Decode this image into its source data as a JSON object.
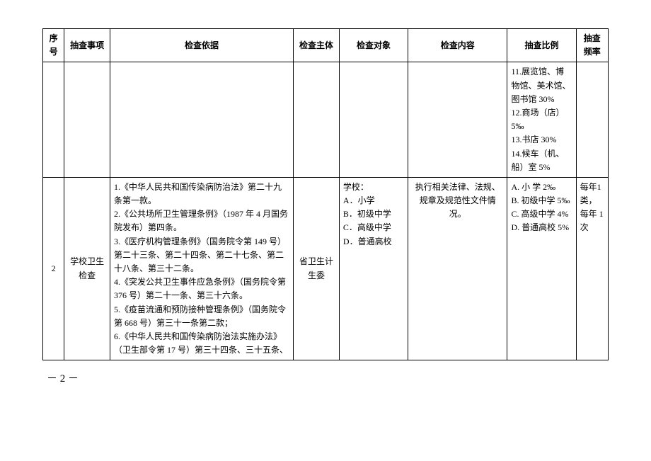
{
  "headers": {
    "seq": "序号",
    "item": "抽查事项",
    "basis": "检查依据",
    "subject": "检查主体",
    "target": "检查对象",
    "content": "检查内容",
    "ratio": "抽查比例",
    "freq": "抽查频率"
  },
  "row1": {
    "ratio_lines": {
      "l1": "11.展览馆、博物馆、美术馆、图书馆 30%",
      "l2": "12.商场（店）5‰",
      "l3": "13.书店  30%",
      "l4": "14.候车（机、船）室 5%"
    }
  },
  "row2": {
    "seq": "2",
    "item": "学校卫生检查",
    "basis": {
      "b1": "1.《中华人民共和国传染病防治法》第二十九条第一款。",
      "b2": "2.《公共场所卫生管理条例》（1987 年 4 月国务院发布）第四条。",
      "b3": "3.《医疗机构管理条例》（国务院令第 149 号）第二十三条、第二十四条、第二十七条、第二十八条、第三十二条。",
      "b4": "4.《突发公共卫生事件应急条例》（国务院令第 376 号）第二十一条、第三十六条。",
      "b5": "5.《疫苗流通和预防接种管理条例》（国务院令第 668 号）第三十一条第二款；",
      "b6": "6.《中华人民共和国传染病防治法实施办法》（卫生部令第 17 号）第三十四条、三十五条、"
    },
    "subject": "省卫生计生委",
    "target": {
      "t0": "学校：",
      "t1": "A．小学",
      "t2": "B．初级中学",
      "t3": "C．高级中学",
      "t4": "D．普通高校"
    },
    "content": "执行相关法律、法规、规章及规范性文件情况。",
    "ratio": {
      "r1": "A. 小  学 2‰",
      "r2": "B. 初级中学  5‰",
      "r3": "C. 高级中学  4%",
      "r4": "D. 普通高校  5%"
    },
    "freq": "每年1 类，每年 1次"
  },
  "page_number": "－ 2 －"
}
